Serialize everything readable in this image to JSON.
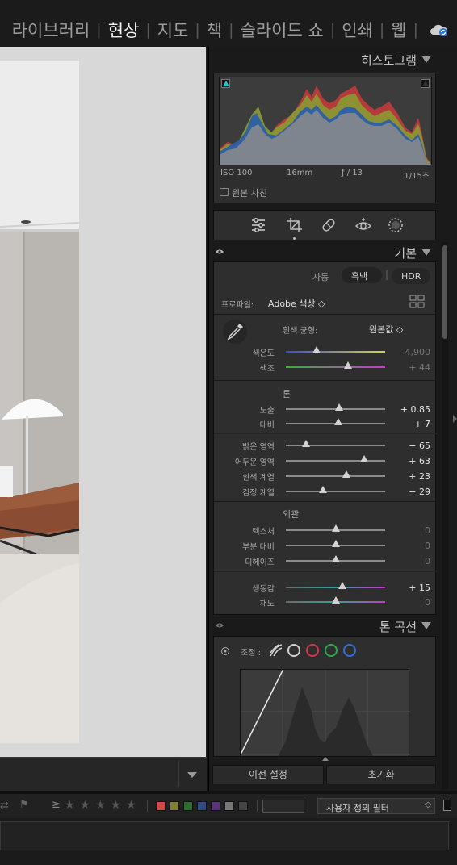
{
  "modules": [
    "라이브러리",
    "현상",
    "지도",
    "책",
    "슬라이드 쇼",
    "인쇄",
    "웹"
  ],
  "active_module": "현상",
  "histogram": {
    "title": "히스토그램",
    "iso": "ISO 100",
    "focal": "16mm",
    "aperture": "ƒ / 13",
    "shutter": "1/15초",
    "original_photo": "원본 사진"
  },
  "basic": {
    "title": "기본",
    "treatment": {
      "color": "자동",
      "bw": "흑백",
      "hdr": "HDR"
    },
    "profile_label": "프로파일:",
    "profile_value": "Adobe 색상 ◇",
    "wb_label": "흰색 균형:",
    "wb_value": "원본값 ◇",
    "temp": {
      "label": "색온도",
      "value": "4,900",
      "pos": 0.31
    },
    "tint": {
      "label": "색조",
      "value": "+ 44",
      "pos": 0.63
    },
    "tone_title": "톤",
    "exposure": {
      "label": "노출",
      "value": "+ 0.85",
      "pos": 0.54
    },
    "contrast": {
      "label": "대비",
      "value": "+ 7",
      "pos": 0.53
    },
    "highlights": {
      "label": "밝은 영역",
      "value": "− 65",
      "pos": 0.2
    },
    "shadows": {
      "label": "어두운 영역",
      "value": "+ 63",
      "pos": 0.79
    },
    "whites": {
      "label": "흰색 계열",
      "value": "+ 23",
      "pos": 0.61
    },
    "blacks": {
      "label": "검정 계열",
      "value": "− 29",
      "pos": 0.37
    },
    "presence_title": "외관",
    "texture": {
      "label": "텍스처",
      "value": "0",
      "pos": 0.5
    },
    "clarity": {
      "label": "부분 대비",
      "value": "0",
      "pos": 0.5
    },
    "dehaze": {
      "label": "디헤이즈",
      "value": "0",
      "pos": 0.5
    },
    "vibrance": {
      "label": "생동감",
      "value": "+ 15",
      "pos": 0.57
    },
    "saturation": {
      "label": "채도",
      "value": "0",
      "pos": 0.5
    }
  },
  "tone_curve": {
    "title": "톤 곡선",
    "adjust_label": "조정 :"
  },
  "buttons": {
    "previous": "이전 설정",
    "reset": "초기화"
  },
  "filterbar": {
    "rating_op": "≥",
    "stars": "★",
    "filter_select": "사용자 정의 필터"
  },
  "colors": {
    "label_red": "#d04848",
    "label_yellow": "#808033",
    "label_green": "#2f6b35",
    "label_blue": "#334a88",
    "label_purple": "#5a357a"
  }
}
